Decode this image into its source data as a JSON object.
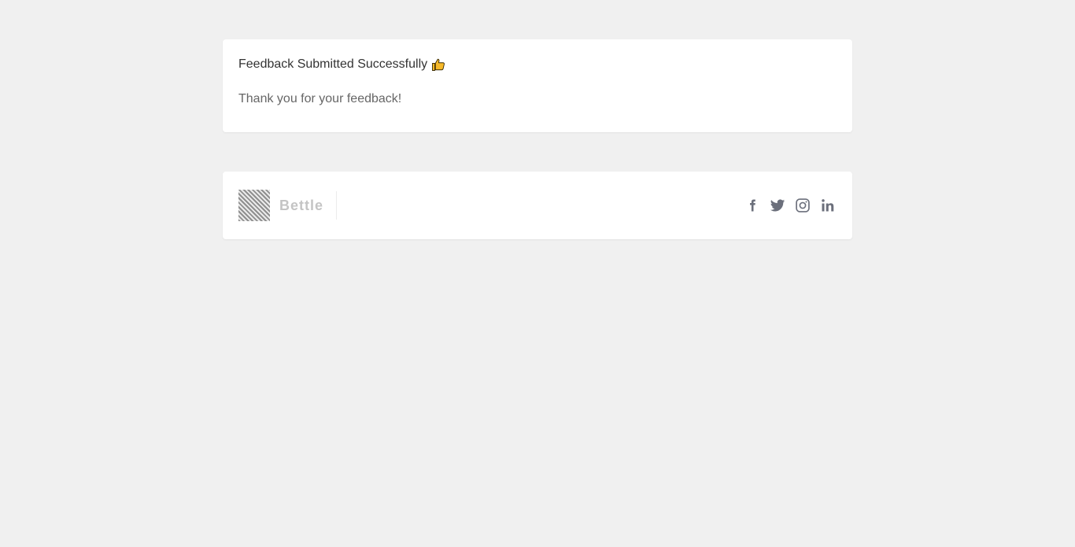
{
  "success": {
    "title": "Feedback Submitted Successfully",
    "title_icon": "thumbs-up-icon",
    "message": "Thank you for your feedback!"
  },
  "footer": {
    "brand_name": "Bettle",
    "brand_logo": "brand-logo-image",
    "socials": [
      {
        "name": "facebook-icon",
        "label": "Facebook"
      },
      {
        "name": "twitter-icon",
        "label": "Twitter"
      },
      {
        "name": "instagram-icon",
        "label": "Instagram"
      },
      {
        "name": "linkedin-icon",
        "label": "LinkedIn"
      }
    ],
    "social_color": "#6b6f7b"
  },
  "colors": {
    "background": "#f0f0f0",
    "card": "#ffffff",
    "title_text": "#333333",
    "message_text": "#666666",
    "thumb_fill": "#f7b928"
  }
}
